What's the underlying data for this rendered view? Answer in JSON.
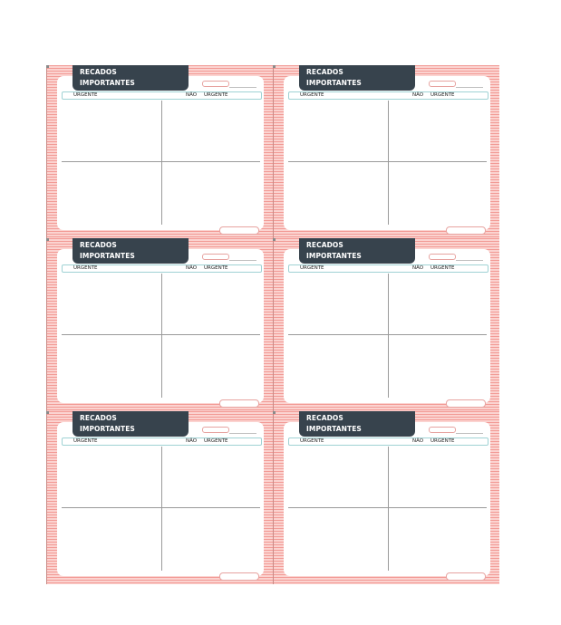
{
  "cards": [
    {
      "title_line1": "RECADOS",
      "title_line2": "IMPORTANTES",
      "urgent_left": "URGENTE",
      "not_urgent_label": "NÃO",
      "urgent_right": "URGENTE"
    },
    {
      "title_line1": "RECADOS",
      "title_line2": "IMPORTANTES",
      "urgent_left": "URGENTE",
      "not_urgent_label": "NÃO",
      "urgent_right": "URGENTE"
    },
    {
      "title_line1": "RECADOS",
      "title_line2": "IMPORTANTES",
      "urgent_left": "URGENTE",
      "not_urgent_label": "NÃO",
      "urgent_right": "URGENTE"
    },
    {
      "title_line1": "RECADOS",
      "title_line2": "IMPORTANTES",
      "urgent_left": "URGENTE",
      "not_urgent_label": "NÃO",
      "urgent_right": "URGENTE"
    },
    {
      "title_line1": "RECADOS",
      "title_line2": "IMPORTANTES",
      "urgent_left": "URGENTE",
      "not_urgent_label": "NÃO",
      "urgent_right": "URGENTE"
    },
    {
      "title_line1": "RECADOS",
      "title_line2": "IMPORTANTES",
      "urgent_left": "URGENTE",
      "not_urgent_label": "NÃO",
      "urgent_right": "URGENTE"
    }
  ],
  "colors": {
    "header": "#37434d",
    "stripe_dark": "#f29a95",
    "stripe_light": "#fbd3d0",
    "urgency_border": "#9fd2d4",
    "accent_box_border": "#e7a3a0"
  }
}
